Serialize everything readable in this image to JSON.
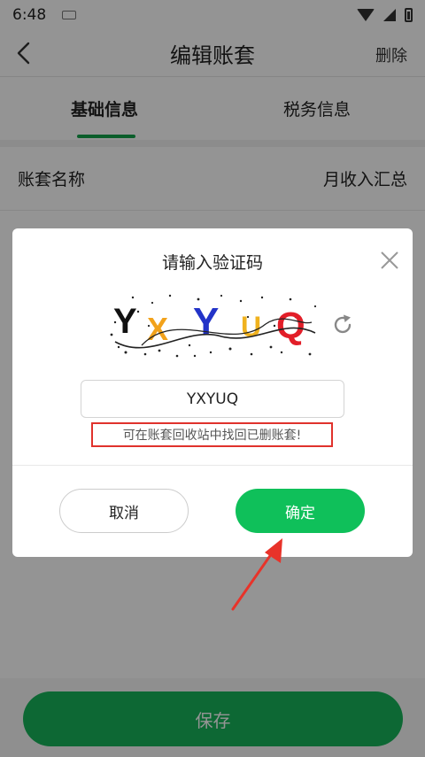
{
  "status_bar": {
    "time": "6:48"
  },
  "nav": {
    "title": "编辑账套",
    "delete_label": "删除"
  },
  "tabs": [
    {
      "label": "基础信息",
      "active": true
    },
    {
      "label": "税务信息",
      "active": false
    }
  ],
  "form": {
    "rows": [
      {
        "label": "账套名称",
        "value": "月收入汇总"
      }
    ]
  },
  "save_label": "保存",
  "dialog": {
    "title": "请输入验证码",
    "captcha_text": "YXYUQ",
    "input_value": "YXYUQ",
    "hint": "可在账套回收站中找回已删账套!",
    "cancel_label": "取消",
    "confirm_label": "确定"
  },
  "colors": {
    "accent_green": "#13a34b",
    "confirm_green": "#0fc05a",
    "hint_red": "#e0322c"
  }
}
